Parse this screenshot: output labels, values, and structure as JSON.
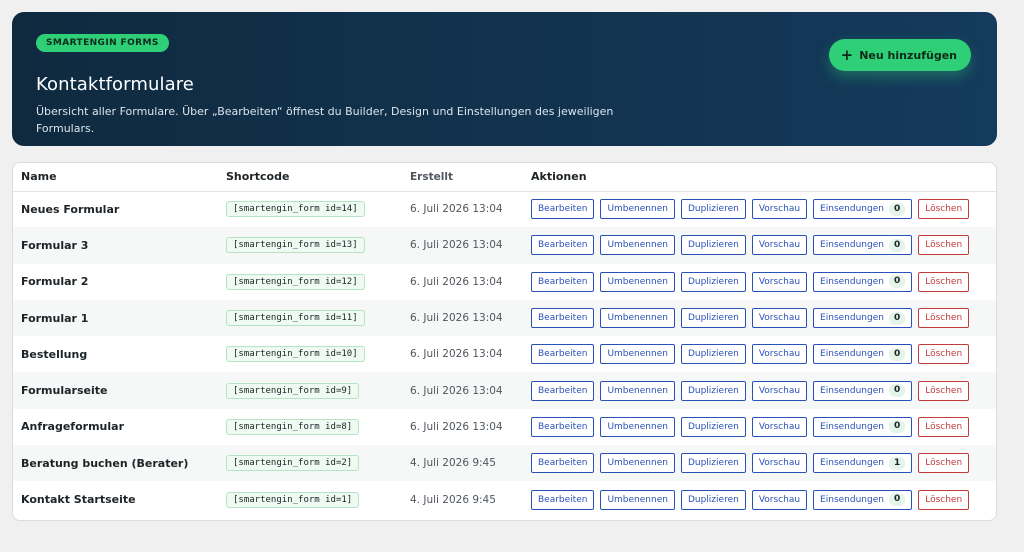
{
  "header": {
    "badge": "SMARTENGIN FORMS",
    "title": "Kontaktformulare",
    "subtitle": "Übersicht aller Formulare. Über „Bearbeiten“ öffnest du Builder, Design und Einstellungen des jeweiligen Formulars.",
    "add_button": "Neu hinzufügen",
    "add_icon": "+"
  },
  "table": {
    "columns": [
      "Name",
      "Shortcode",
      "Erstellt",
      "Aktionen"
    ],
    "actions": {
      "edit": "Bearbeiten",
      "rename": "Umbenennen",
      "duplicate": "Duplizieren",
      "preview": "Vorschau",
      "submissions": "Einsendungen",
      "delete": "Löschen"
    },
    "rows": [
      {
        "name": "Neues Formular",
        "shortcode": "[smartengin_form id=14]",
        "created": "6. Juli 2026 13:04",
        "submissions": "0"
      },
      {
        "name": "Formular 3",
        "shortcode": "[smartengin_form id=13]",
        "created": "6. Juli 2026 13:04",
        "submissions": "0"
      },
      {
        "name": "Formular 2",
        "shortcode": "[smartengin_form id=12]",
        "created": "6. Juli 2026 13:04",
        "submissions": "0"
      },
      {
        "name": "Formular 1",
        "shortcode": "[smartengin_form id=11]",
        "created": "6. Juli 2026 13:04",
        "submissions": "0"
      },
      {
        "name": "Bestellung",
        "shortcode": "[smartengin_form id=10]",
        "created": "6. Juli 2026 13:04",
        "submissions": "0"
      },
      {
        "name": "Formularseite",
        "shortcode": "[smartengin_form id=9]",
        "created": "6. Juli 2026 13:04",
        "submissions": "0"
      },
      {
        "name": "Anfrageformular",
        "shortcode": "[smartengin_form id=8]",
        "created": "6. Juli 2026 13:04",
        "submissions": "0"
      },
      {
        "name": "Beratung buchen (Berater)",
        "shortcode": "[smartengin_form id=2]",
        "created": "4. Juli 2026 9:45",
        "submissions": "1"
      },
      {
        "name": "Kontakt Startseite",
        "shortcode": "[smartengin_form id=1]",
        "created": "4. Juli 2026 9:45",
        "submissions": "0"
      }
    ]
  }
}
